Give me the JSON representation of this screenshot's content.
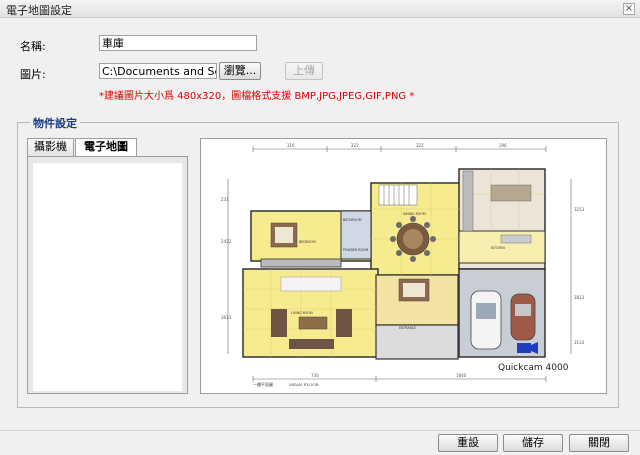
{
  "window": {
    "title": "電子地圖設定",
    "close_glyph": "×"
  },
  "form": {
    "name_label": "名稱:",
    "name_value": "車庫",
    "image_label": "圖片:",
    "image_value": "C:\\Documents and Settin",
    "browse_label": "瀏覽...",
    "upload_label": "上傳",
    "hint": "*建議圖片大小爲 480x320，圖檔格式支援 BMP,JPG,JPEG,GIF,PNG *"
  },
  "objects": {
    "legend": "物件設定",
    "tabs": [
      {
        "label": "攝影機",
        "active": false
      },
      {
        "label": "電子地圖",
        "active": true
      }
    ]
  },
  "map": {
    "camera_label": "Quickcam 4000",
    "top_dims": [
      "316",
      "222",
      "322",
      "296"
    ],
    "bottom_dims": [
      "730",
      "1840"
    ],
    "left_dims": [
      "231",
      "2422",
      "3613"
    ],
    "right_dims": [
      "3253",
      "2813",
      "3133"
    ],
    "caption_cn": "一樓平面圖",
    "caption_en": "MEAN FLOOR",
    "rooms": {
      "bathroom": "BATHROOM",
      "bedroom": "BEDROOM",
      "dining": "DINING ROOM",
      "kitchen": "KITCHEN",
      "living": "LIVING ROOM",
      "entrance": "ENTRANCE",
      "powder": "POWDER ROOM"
    }
  },
  "footer": {
    "reset_label": "重設",
    "save_label": "儲存",
    "close_label": "關閉"
  },
  "colors": {
    "hint_red": "#e00000",
    "legend_blue": "#1a3b86",
    "room_yellow": "#f6eb8e",
    "garage_gray": "#c9ced6",
    "camera_blue": "#1d3fbf"
  }
}
